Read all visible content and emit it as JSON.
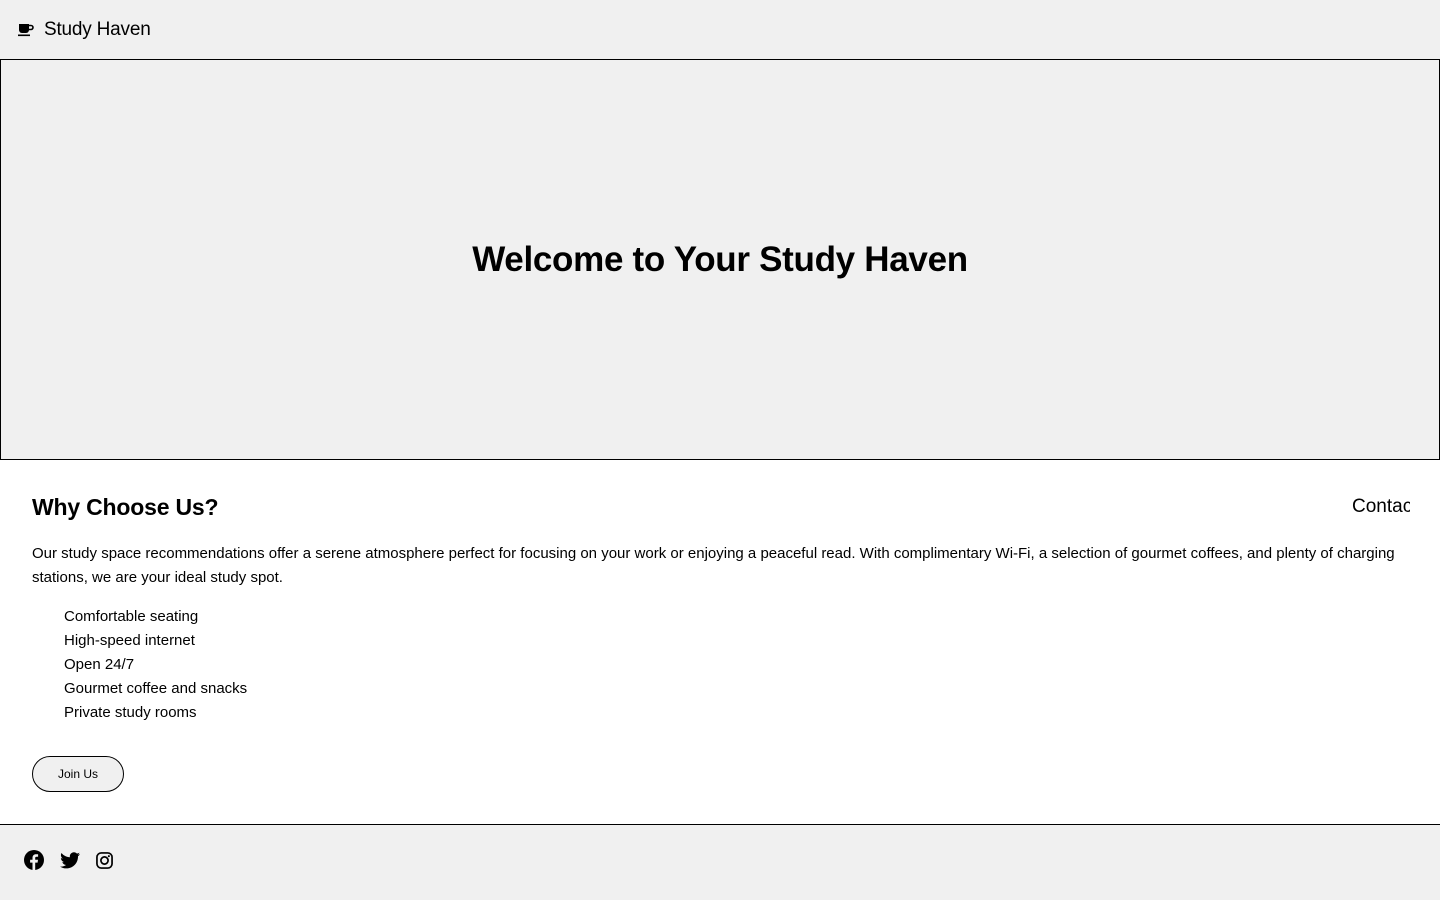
{
  "header": {
    "brand_icon": "coffee-cup-icon",
    "brand_name": "Study Haven"
  },
  "hero": {
    "title": "Welcome to Your Study Haven"
  },
  "main": {
    "section_title": "Why Choose Us?",
    "nav_contact_label": "Contact",
    "description": "Our study space recommendations offer a serene atmosphere perfect for focusing on your work or enjoying a peaceful read. With complimentary Wi-Fi, a selection of gourmet coffees, and plenty of charging stations, we are your ideal study spot.",
    "features": [
      "Comfortable seating",
      "High-speed internet",
      "Open 24/7",
      "Gourmet coffee and snacks",
      "Private study rooms"
    ],
    "join_button_label": "Join Us"
  },
  "footer": {
    "social_icons": [
      "facebook-icon",
      "twitter-icon",
      "instagram-icon"
    ]
  },
  "colors": {
    "background_gray": "#f0f0f0",
    "content_background": "#ffffff",
    "text": "#000000",
    "border": "#000000"
  }
}
